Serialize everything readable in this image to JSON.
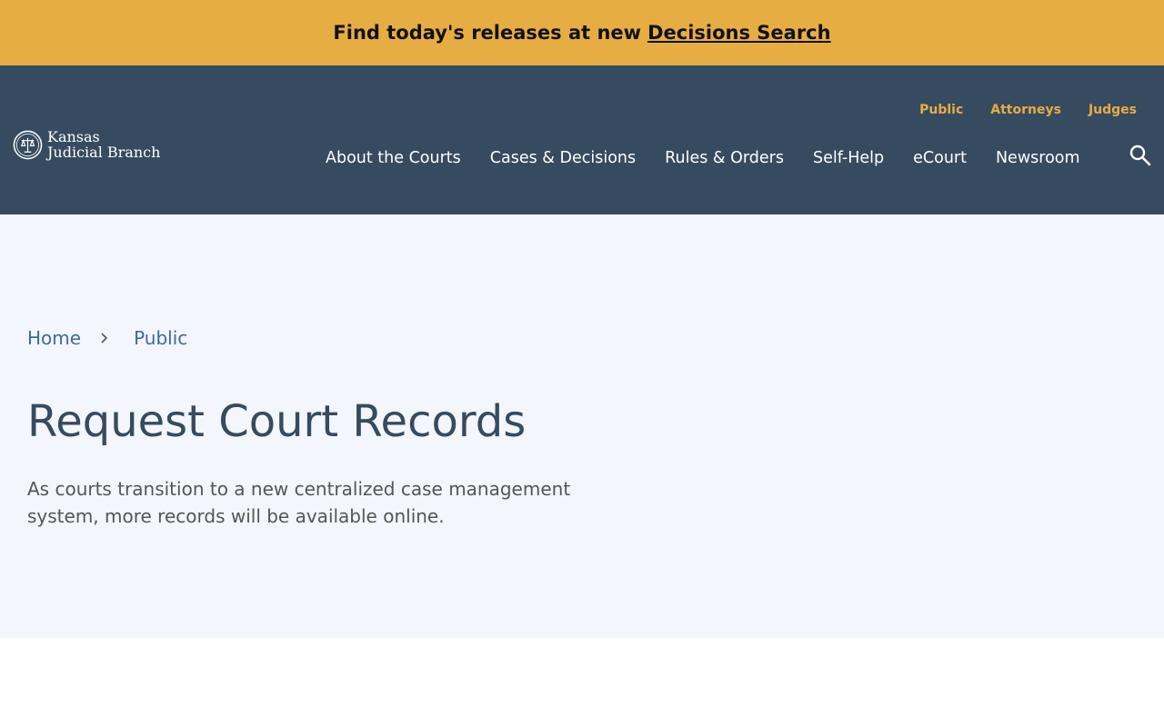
{
  "alert": {
    "text": "Find today's releases at new",
    "link_label": "Decisions Search"
  },
  "logo": {
    "line1": "Kansas",
    "line2": "Judicial Branch",
    "icon": "court-seal-icon"
  },
  "utility_nav": [
    {
      "label": "Public"
    },
    {
      "label": "Attorneys"
    },
    {
      "label": "Judges"
    }
  ],
  "main_nav": [
    {
      "label": "About the Courts"
    },
    {
      "label": "Cases & Decisions"
    },
    {
      "label": "Rules & Orders"
    },
    {
      "label": "Self-Help"
    },
    {
      "label": "eCourt"
    },
    {
      "label": "Newsroom"
    }
  ],
  "search": {
    "icon": "search-icon"
  },
  "breadcrumb": [
    {
      "label": "Home"
    },
    {
      "label": "Public"
    }
  ],
  "page": {
    "title": "Request Court Records",
    "intro": "As courts transition to a new centralized case management system, more records will be available online."
  },
  "colors": {
    "alert_bg": "#e6ad42",
    "header_bg": "#364b5f",
    "hero_bg": "#f3f6fc",
    "link": "#3d6aa3",
    "accent": "#e6ad42"
  }
}
